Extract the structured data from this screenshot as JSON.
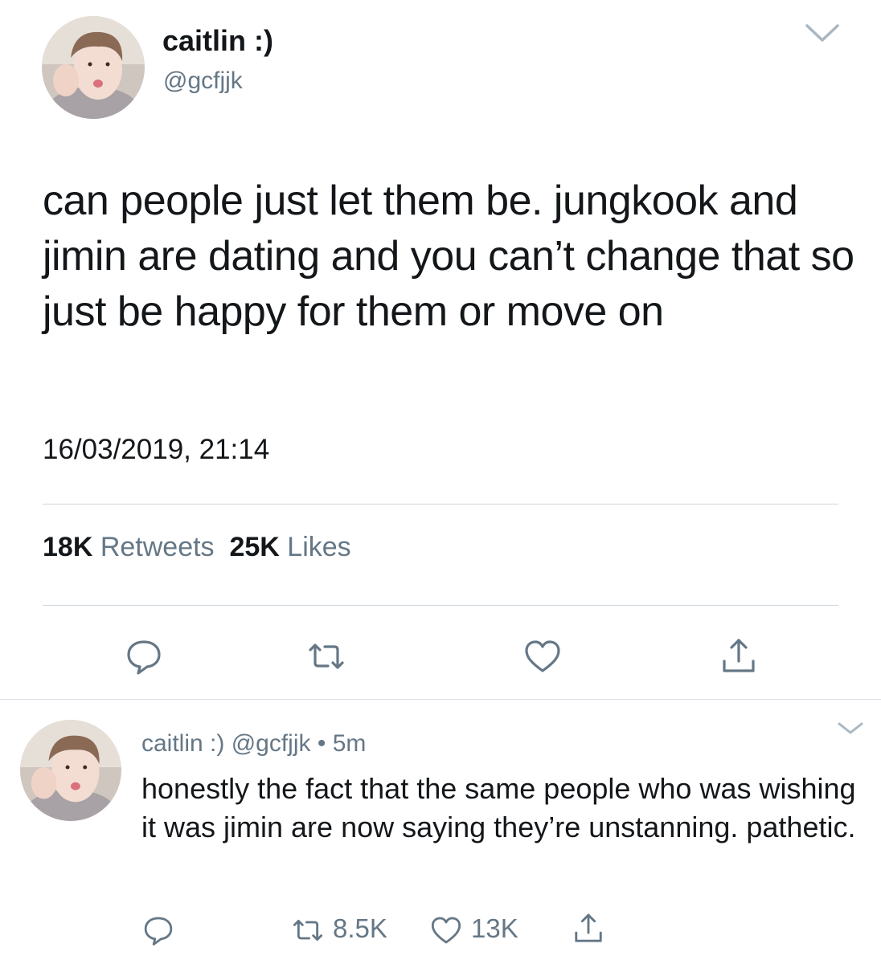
{
  "main_tweet": {
    "display_name": "caitlin :)",
    "handle": "@gcfjjk",
    "text": "can people just let them be. jungkook and jimin are dating and you can’t change that so just be happy for them or move on",
    "timestamp": "16/03/2019, 21:14",
    "stats": {
      "retweets_count": "18K",
      "retweets_label": "Retweets",
      "likes_count": "25K",
      "likes_label": "Likes"
    },
    "actions": [
      "reply-icon",
      "retweet-icon",
      "like-icon",
      "share-icon"
    ]
  },
  "reply_tweet": {
    "display_name": "caitlin :)",
    "handle": "@gcfjjk",
    "separator": "•",
    "age": "5m",
    "text": "honestly the fact that the same people who was wishing it was jimin are now saying they’re unstanning. pathetic.",
    "retweet_count": "8.5K",
    "like_count": "13K"
  },
  "colors": {
    "text": "#14171a",
    "secondary": "#657786",
    "divider": "#ccd6dd"
  }
}
